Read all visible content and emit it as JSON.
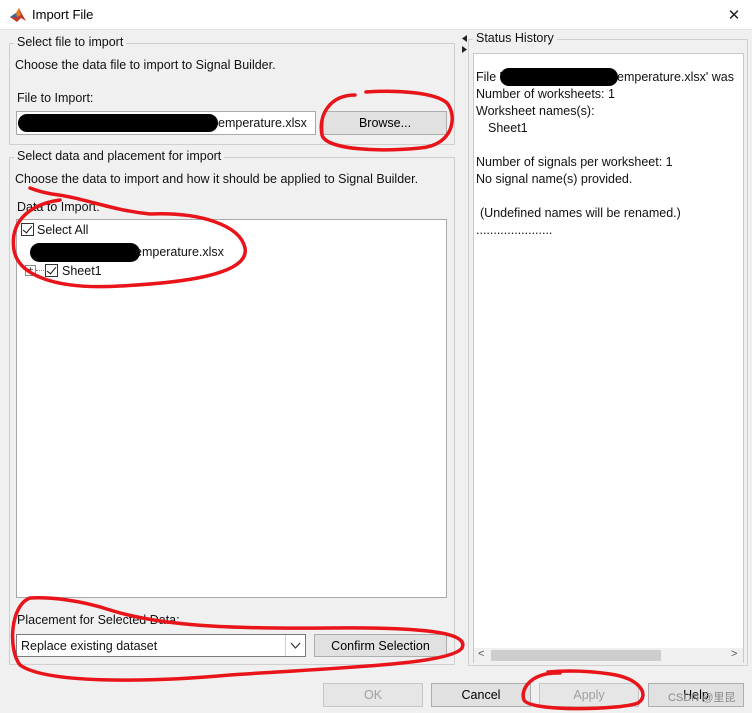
{
  "window": {
    "title": "Import File",
    "close_glyph": "✕",
    "icon": "matlab-icon"
  },
  "file_group": {
    "legend": "Select file to import",
    "description": "Choose the data file to import to Signal Builder.",
    "file_label": "File to Import:",
    "file_value_visible": "emperature.xlsx",
    "browse_label": "Browse..."
  },
  "data_group": {
    "legend": "Select data and placement for import",
    "description": "Choose the data to import and how it should be applied to Signal Builder.",
    "data_label": "Data to Import:",
    "tree": {
      "select_all": "Select All",
      "file_node": "emperature.xlsx",
      "expand_glyph": "+",
      "sheet": "Sheet1"
    },
    "placement_label": "Placement for Selected Data:",
    "placement_value": "Replace existing dataset",
    "confirm_label": "Confirm Selection"
  },
  "status": {
    "legend": "Status History",
    "lines": [
      "File '",
      "Number of worksheets: 1",
      "Worksheet names(s):",
      "Sheet1",
      "",
      "Number of signals per worksheet: 1",
      "No signal name(s) provided.",
      "",
      "(Undefined names will be renamed.)",
      "......................"
    ],
    "first_line_tail": "emperature.xlsx' was",
    "scroll_left": "<",
    "scroll_right": ">"
  },
  "footer": {
    "ok": "OK",
    "cancel": "Cancel",
    "apply": "Apply",
    "help": "Help",
    "watermark": "CSDN @里昆"
  },
  "colors": {
    "annotation_red": "#e8141a",
    "selection_blue": "#0078d7"
  }
}
